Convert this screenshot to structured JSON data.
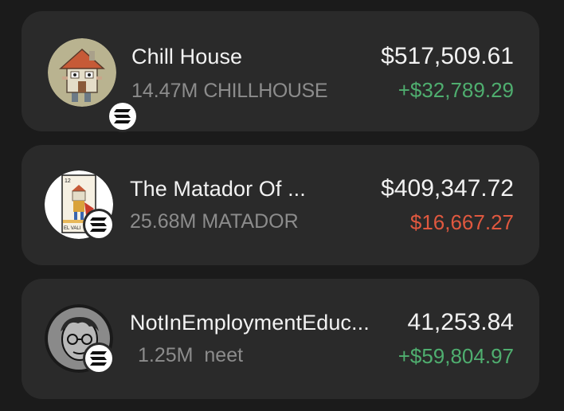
{
  "colors": {
    "background": "#1b1b1b",
    "card": "#2a2a2a",
    "text_primary": "#f2f2f2",
    "text_secondary": "#8c8c8c",
    "positive": "#4fae6f",
    "negative": "#e0583f"
  },
  "tokens": [
    {
      "name": "Chill House",
      "amount": "14.47M",
      "symbol": "CHILLHOUSE",
      "value": "$517,509.61",
      "pnl": "+$32,789.29",
      "pnl_direction": "positive",
      "icon": "house-character-icon",
      "chain_icon": "solana-icon"
    },
    {
      "name": "The Matador Of ...",
      "amount": "25.68M",
      "symbol": "MATADOR",
      "value": "$409,347.72",
      "pnl": "$16,667.27",
      "pnl_direction": "negative",
      "icon": "matador-card-icon",
      "card_caption": "EL VALI",
      "chain_icon": "solana-icon"
    },
    {
      "name": "NotInEmploymentEduc...",
      "amount": "1.25M",
      "symbol": "neet",
      "value": "41,253.84",
      "pnl": "+$59,804.97",
      "pnl_direction": "positive",
      "icon": "neet-character-icon",
      "chain_icon": "solana-icon"
    }
  ]
}
